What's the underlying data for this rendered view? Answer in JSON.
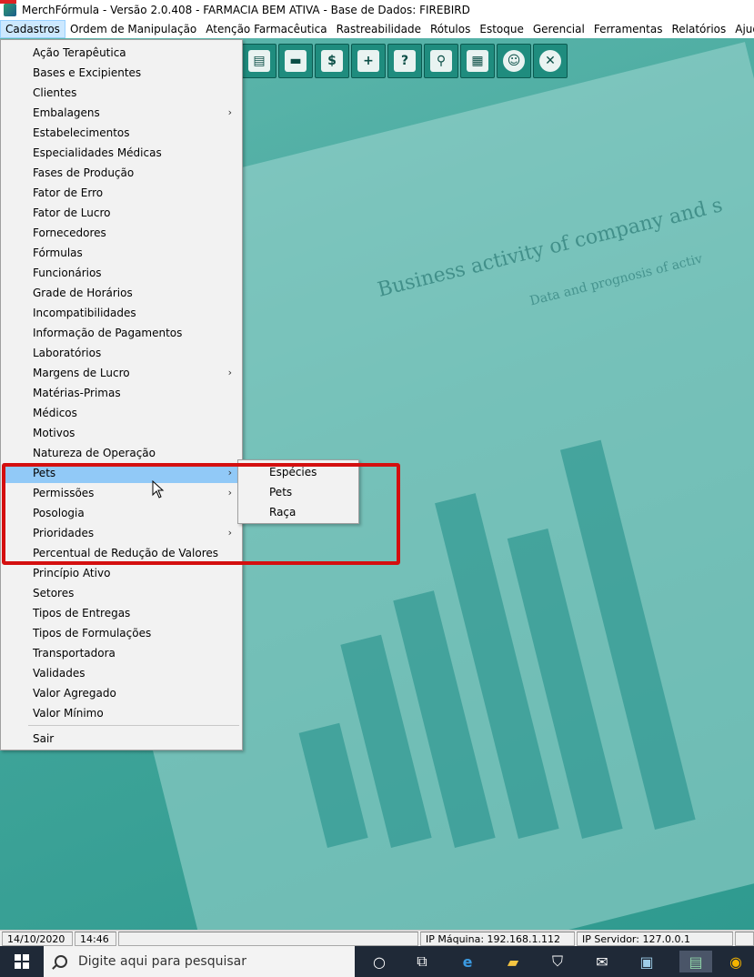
{
  "window": {
    "title": "MerchFórmula - Versão 2.0.408 - FARMACIA BEM ATIVA - Base de Dados: FIREBIRD"
  },
  "menubar": {
    "items": [
      "Cadastros",
      "Ordem de Manipulação",
      "Atenção Farmacêutica",
      "Rastreabilidade",
      "Rótulos",
      "Estoque",
      "Gerencial",
      "Ferramentas",
      "Relatórios",
      "Ajuda"
    ]
  },
  "background": {
    "title": "Business activity of company and s",
    "subtitle": "Data and prognosis of activ"
  },
  "toolbar": {
    "icons": [
      "document-icon",
      "folder-icon",
      "money-document-icon",
      "add-document-icon",
      "help-document-icon",
      "search-document-icon",
      "calculator-icon",
      "user-chat-icon",
      "close-icon"
    ]
  },
  "cadastros_menu": {
    "items": [
      {
        "label": "Ação Terapêutica",
        "submenu": false
      },
      {
        "label": "Bases e Excipientes",
        "submenu": false
      },
      {
        "label": "Clientes",
        "submenu": false
      },
      {
        "label": "Embalagens",
        "submenu": true
      },
      {
        "label": "Estabelecimentos",
        "submenu": false
      },
      {
        "label": "Especialidades Médicas",
        "submenu": false
      },
      {
        "label": "Fases de Produção",
        "submenu": false
      },
      {
        "label": "Fator de Erro",
        "submenu": false
      },
      {
        "label": "Fator de Lucro",
        "submenu": false
      },
      {
        "label": "Fornecedores",
        "submenu": false
      },
      {
        "label": "Fórmulas",
        "submenu": false
      },
      {
        "label": "Funcionários",
        "submenu": false
      },
      {
        "label": "Grade de Horários",
        "submenu": false
      },
      {
        "label": "Incompatibilidades",
        "submenu": false
      },
      {
        "label": "Informação de Pagamentos",
        "submenu": false
      },
      {
        "label": "Laboratórios",
        "submenu": false
      },
      {
        "label": "Margens de Lucro",
        "submenu": true
      },
      {
        "label": "Matérias-Primas",
        "submenu": false
      },
      {
        "label": "Médicos",
        "submenu": false
      },
      {
        "label": "Motivos",
        "submenu": false
      },
      {
        "label": "Natureza de Operação",
        "submenu": false
      },
      {
        "label": "Pets",
        "submenu": true,
        "highlighted": true
      },
      {
        "label": "Permissões",
        "submenu": true
      },
      {
        "label": "Posologia",
        "submenu": false
      },
      {
        "label": "Prioridades",
        "submenu": true
      },
      {
        "label": "Percentual de Redução de Valores",
        "submenu": false
      },
      {
        "label": "Princípio Ativo",
        "submenu": false
      },
      {
        "label": "Setores",
        "submenu": false
      },
      {
        "label": "Tipos de Entregas",
        "submenu": false
      },
      {
        "label": "Tipos de Formulações",
        "submenu": false
      },
      {
        "label": "Transportadora",
        "submenu": false
      },
      {
        "label": "Validades",
        "submenu": false
      },
      {
        "label": "Valor Agregado",
        "submenu": false
      },
      {
        "label": "Valor Mínimo",
        "submenu": false
      }
    ],
    "exit_label": "Sair",
    "arrow": "›"
  },
  "pets_submenu": {
    "items": [
      "Espécies",
      "Pets",
      "Raça"
    ]
  },
  "statusbar": {
    "date": "14/10/2020",
    "time": "14:46",
    "ip_machine": "IP Máquina: 192.168.1.112",
    "ip_server": "IP Servidor: 127.0.0.1"
  },
  "taskbar": {
    "search_placeholder": "Digite aqui para pesquisar",
    "accent": "#1f2937"
  }
}
